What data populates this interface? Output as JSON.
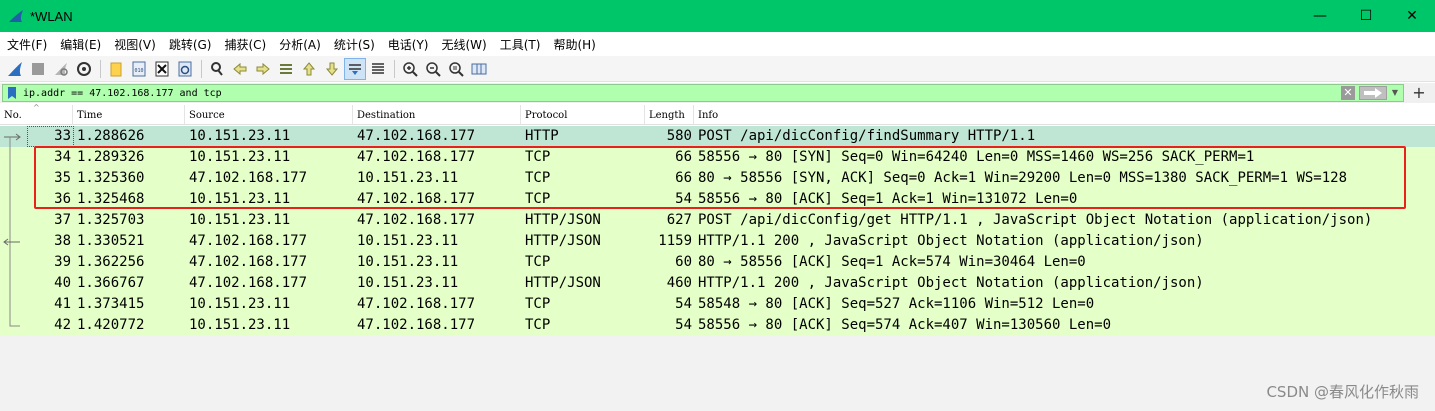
{
  "window": {
    "title": "*WLAN",
    "minimize": "—",
    "maximize": "☐",
    "close": "✕"
  },
  "menu": [
    "文件(F)",
    "编辑(E)",
    "视图(V)",
    "跳转(G)",
    "捕获(C)",
    "分析(A)",
    "统计(S)",
    "电话(Y)",
    "无线(W)",
    "工具(T)",
    "帮助(H)"
  ],
  "filter": {
    "value": "ip.addr == 47.102.168.177 and tcp",
    "add_button": "+"
  },
  "columns": {
    "no": "No.",
    "time": "Time",
    "source": "Source",
    "destination": "Destination",
    "protocol": "Protocol",
    "length": "Length",
    "info": "Info"
  },
  "packets": [
    {
      "no": "33",
      "time": "1.288626",
      "source": "10.151.23.11",
      "destination": "47.102.168.177",
      "protocol": "HTTP",
      "length": "580",
      "info": "POST /api/dicConfig/findSummary HTTP/1.1"
    },
    {
      "no": "34",
      "time": "1.289326",
      "source": "10.151.23.11",
      "destination": "47.102.168.177",
      "protocol": "TCP",
      "length": "66",
      "info": "58556 → 80 [SYN] Seq=0 Win=64240 Len=0 MSS=1460 WS=256 SACK_PERM=1"
    },
    {
      "no": "35",
      "time": "1.325360",
      "source": "47.102.168.177",
      "destination": "10.151.23.11",
      "protocol": "TCP",
      "length": "66",
      "info": "80 → 58556 [SYN, ACK] Seq=0 Ack=1 Win=29200 Len=0 MSS=1380 SACK_PERM=1 WS=128"
    },
    {
      "no": "36",
      "time": "1.325468",
      "source": "10.151.23.11",
      "destination": "47.102.168.177",
      "protocol": "TCP",
      "length": "54",
      "info": "58556 → 80 [ACK] Seq=1 Ack=1 Win=131072 Len=0"
    },
    {
      "no": "37",
      "time": "1.325703",
      "source": "10.151.23.11",
      "destination": "47.102.168.177",
      "protocol": "HTTP/JSON",
      "length": "627",
      "info": "POST /api/dicConfig/get HTTP/1.1 , JavaScript Object Notation (application/json)"
    },
    {
      "no": "38",
      "time": "1.330521",
      "source": "47.102.168.177",
      "destination": "10.151.23.11",
      "protocol": "HTTP/JSON",
      "length": "1159",
      "info": "HTTP/1.1 200  , JavaScript Object Notation (application/json)"
    },
    {
      "no": "39",
      "time": "1.362256",
      "source": "47.102.168.177",
      "destination": "10.151.23.11",
      "protocol": "TCP",
      "length": "60",
      "info": "80 → 58556 [ACK] Seq=1 Ack=574 Win=30464 Len=0"
    },
    {
      "no": "40",
      "time": "1.366767",
      "source": "47.102.168.177",
      "destination": "10.151.23.11",
      "protocol": "HTTP/JSON",
      "length": "460",
      "info": "HTTP/1.1 200  , JavaScript Object Notation (application/json)"
    },
    {
      "no": "41",
      "time": "1.373415",
      "source": "10.151.23.11",
      "destination": "47.102.168.177",
      "protocol": "TCP",
      "length": "54",
      "info": "58548 → 80 [ACK] Seq=527 Ack=1106 Win=512 Len=0"
    },
    {
      "no": "42",
      "time": "1.420772",
      "source": "10.151.23.11",
      "destination": "47.102.168.177",
      "protocol": "TCP",
      "length": "54",
      "info": "58556 → 80 [ACK] Seq=574 Ack=407 Win=130560 Len=0"
    }
  ],
  "selected_packet": "33",
  "watermark": "CSDN @春风化作秋雨",
  "colors": {
    "titlebar": "#00c66a",
    "filter_valid": "#afffaf",
    "row_tcp_http": "#e4ffc7",
    "row_selected": "#bfe5d4",
    "annotation_box": "#e8211a"
  }
}
